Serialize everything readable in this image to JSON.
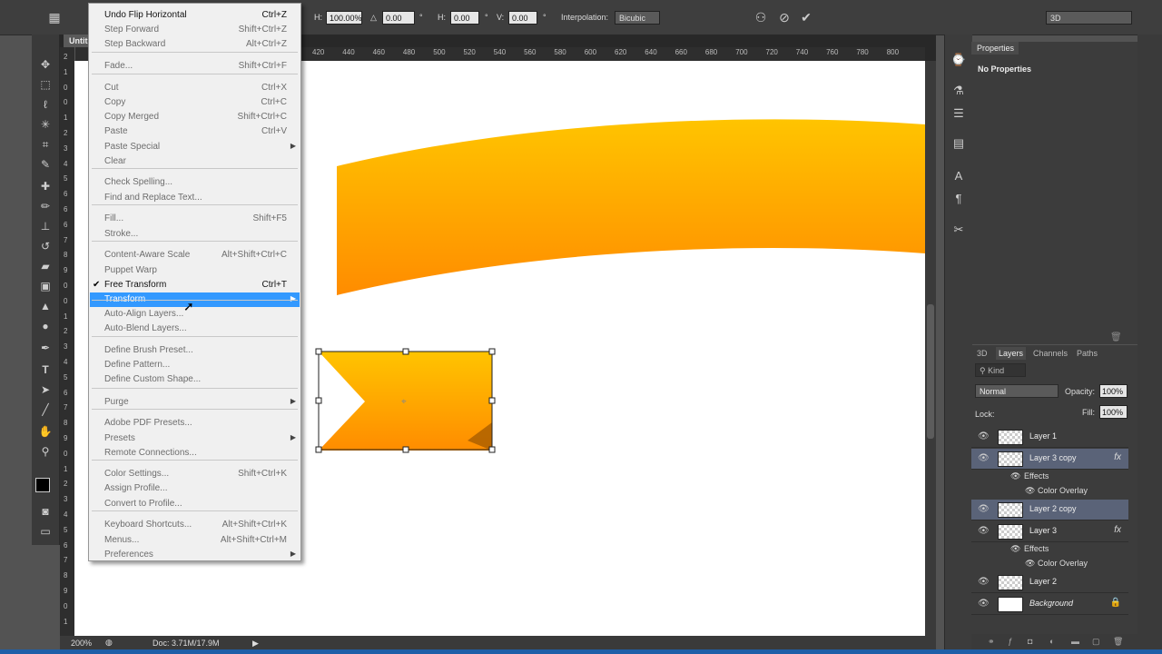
{
  "options_bar": {
    "h_label": "H:",
    "h_value": "100.00%",
    "angle_value": "0.00",
    "degree_sign": "°",
    "skew_h_label": "H:",
    "skew_h_value": "0.00",
    "skew_v_label": "V:",
    "skew_v_value": "0.00",
    "interpolation_label": "Interpolation:",
    "interpolation_value": "Bicubic",
    "workspace_value": "3D"
  },
  "document": {
    "tab_label": "Untit",
    "zoom": "200%",
    "doc_info": "Doc: 3.71M/17.9M",
    "ruler_top": [
      "420",
      "440",
      "460",
      "480",
      "500",
      "520",
      "540",
      "560",
      "580",
      "600",
      "620",
      "640",
      "660",
      "680",
      "700",
      "720",
      "740",
      "760",
      "780",
      "800"
    ],
    "ruler_left": [
      "2",
      "1",
      "0",
      "0",
      "1",
      "2",
      "3",
      "4",
      "5",
      "6",
      "6",
      "6",
      "7",
      "8",
      "9",
      "0",
      "0",
      "1",
      "2",
      "3",
      "4",
      "5",
      "6",
      "7",
      "8",
      "9",
      "0",
      "1",
      "2",
      "3",
      "4",
      "5",
      "6",
      "7",
      "8",
      "9",
      "0",
      "1"
    ]
  },
  "menu": {
    "items": [
      {
        "label": "Undo Flip Horizontal",
        "shortcut": "Ctrl+Z",
        "enabled": true
      },
      {
        "label": "Step Forward",
        "shortcut": "Shift+Ctrl+Z",
        "enabled": false
      },
      {
        "label": "Step Backward",
        "shortcut": "Alt+Ctrl+Z",
        "enabled": false
      },
      {
        "label": "Fade...",
        "shortcut": "Shift+Ctrl+F",
        "enabled": false
      },
      {
        "label": "Cut",
        "shortcut": "Ctrl+X",
        "enabled": false
      },
      {
        "label": "Copy",
        "shortcut": "Ctrl+C",
        "enabled": false
      },
      {
        "label": "Copy Merged",
        "shortcut": "Shift+Ctrl+C",
        "enabled": false
      },
      {
        "label": "Paste",
        "shortcut": "Ctrl+V",
        "enabled": false
      },
      {
        "label": "Paste Special",
        "shortcut": "",
        "enabled": false
      },
      {
        "label": "Clear",
        "shortcut": "",
        "enabled": false
      },
      {
        "label": "Check Spelling...",
        "shortcut": "",
        "enabled": false
      },
      {
        "label": "Find and Replace Text...",
        "shortcut": "",
        "enabled": false
      },
      {
        "label": "Fill...",
        "shortcut": "Shift+F5",
        "enabled": false
      },
      {
        "label": "Stroke...",
        "shortcut": "",
        "enabled": false
      },
      {
        "label": "Content-Aware Scale",
        "shortcut": "Alt+Shift+Ctrl+C",
        "enabled": false
      },
      {
        "label": "Puppet Warp",
        "shortcut": "",
        "enabled": false
      },
      {
        "label": "Free Transform",
        "shortcut": "Ctrl+T",
        "enabled": true
      },
      {
        "label": "Transform",
        "shortcut": "",
        "enabled": true
      },
      {
        "label": "Auto-Align Layers...",
        "shortcut": "",
        "enabled": false
      },
      {
        "label": "Auto-Blend Layers...",
        "shortcut": "",
        "enabled": false
      },
      {
        "label": "Define Brush Preset...",
        "shortcut": "",
        "enabled": false
      },
      {
        "label": "Define Pattern...",
        "shortcut": "",
        "enabled": false
      },
      {
        "label": "Define Custom Shape...",
        "shortcut": "",
        "enabled": false
      },
      {
        "label": "Purge",
        "shortcut": "",
        "enabled": false
      },
      {
        "label": "Adobe PDF Presets...",
        "shortcut": "",
        "enabled": false
      },
      {
        "label": "Presets",
        "shortcut": "",
        "enabled": false
      },
      {
        "label": "Remote Connections...",
        "shortcut": "",
        "enabled": false
      },
      {
        "label": "Color Settings...",
        "shortcut": "Shift+Ctrl+K",
        "enabled": false
      },
      {
        "label": "Assign Profile...",
        "shortcut": "",
        "enabled": false
      },
      {
        "label": "Convert to Profile...",
        "shortcut": "",
        "enabled": false
      },
      {
        "label": "Keyboard Shortcuts...",
        "shortcut": "Alt+Shift+Ctrl+K",
        "enabled": false
      },
      {
        "label": "Menus...",
        "shortcut": "Alt+Shift+Ctrl+M",
        "enabled": false
      },
      {
        "label": "Preferences",
        "shortcut": "",
        "enabled": false
      }
    ]
  },
  "properties_panel": {
    "tab": "Properties",
    "empty_text": "No Properties"
  },
  "layers_panel": {
    "tabs": [
      "3D",
      "Layers",
      "Channels",
      "Paths"
    ],
    "filter_label": "Kind",
    "blend_mode": "Normal",
    "opacity_label": "Opacity:",
    "opacity_value": "100%",
    "lock_label": "Lock:",
    "fill_label": "Fill:",
    "fill_value": "100%",
    "effects_label": "Effects",
    "color_overlay_label": "Color Overlay",
    "layers": [
      {
        "name": "Layer 1",
        "fx": false,
        "selected": false
      },
      {
        "name": "Layer 3 copy",
        "fx": true,
        "selected": true
      },
      {
        "name": "Layer 2 copy",
        "fx": false,
        "selected": true
      },
      {
        "name": "Layer 3",
        "fx": true,
        "selected": false
      },
      {
        "name": "Layer 2",
        "fx": false,
        "selected": false
      },
      {
        "name": "Background",
        "fx": false,
        "selected": false
      }
    ],
    "fx_label": "fx"
  },
  "colors": {
    "accent_highlight": "#3399ff",
    "ribbon_top": "#ffc400",
    "ribbon_bottom": "#ff8c00",
    "selected_layer": "#5a6378"
  }
}
